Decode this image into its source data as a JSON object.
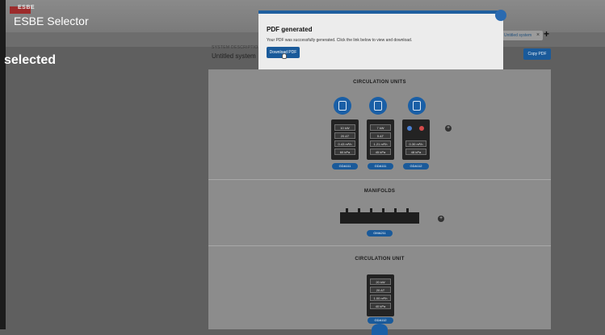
{
  "app": {
    "logo_text": "ESBE",
    "title": "ESBE Selector"
  },
  "tab": {
    "label": "Untitled system",
    "close": "×",
    "add": "+"
  },
  "heading": "selected",
  "system": {
    "description_label": "SYSTEM DESCRIPTION",
    "name": "Untitled system",
    "copy_pdf_label": "Copy PDF"
  },
  "modal": {
    "title": "PDF generated",
    "text": "Your PDF was successfully generated. Click the link below to view and download.",
    "download_label": "Download PDF"
  },
  "sections": {
    "circulation_units": {
      "title": "CIRCULATION UNITS",
      "units": [
        {
          "values": [
            "10 kW",
            "20 ΔT",
            "0.43 m³/h",
            "60 kPa"
          ],
          "tag": "GDA111"
        },
        {
          "values": [
            "7 kW",
            "5 ΔT",
            "1.21 m³/h",
            "45 kPa"
          ],
          "tag": "GDA111"
        },
        {
          "values": [
            "",
            "",
            "0.30 m³/h",
            "48 kPa"
          ],
          "tag": "GDA112"
        }
      ]
    },
    "manifolds": {
      "title": "MANIFOLDS",
      "tag": "GMA211"
    },
    "circulation_unit": {
      "title": "CIRCULATION UNIT",
      "values": [
        "20 kW",
        "20 ΔT",
        "1.00 m³/h",
        "40 kPa"
      ],
      "tag": "GDA112"
    }
  }
}
